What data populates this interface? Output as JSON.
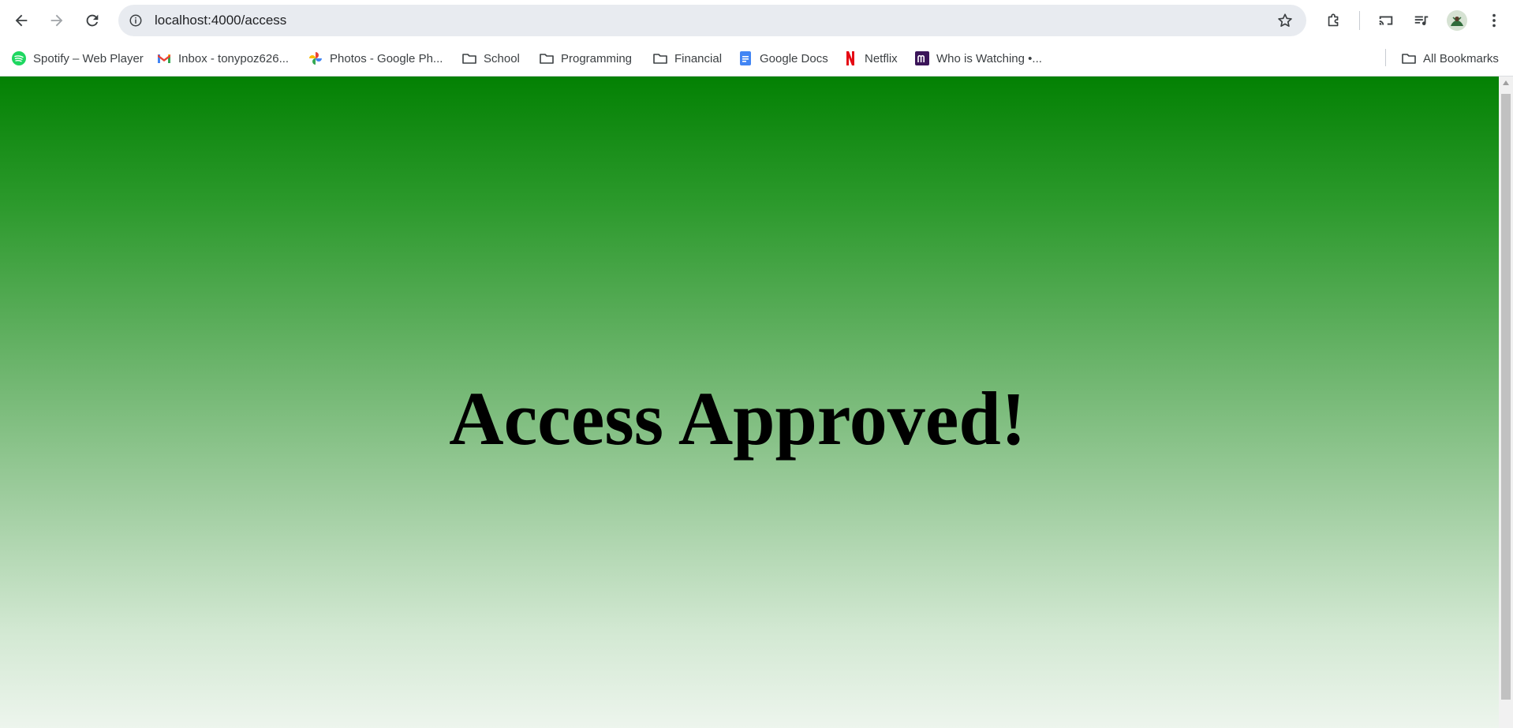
{
  "browser": {
    "url": "localhost:4000/access",
    "avatar_color": "#d6e2d3"
  },
  "bookmarks": [
    {
      "label": "Spotify – Web Player",
      "icon": "spotify-icon"
    },
    {
      "label": "Inbox - tonypoz626...",
      "icon": "gmail-icon"
    },
    {
      "label": "Photos - Google Ph...",
      "icon": "google-photos-icon"
    },
    {
      "label": "School",
      "icon": "folder-icon"
    },
    {
      "label": "Programming",
      "icon": "folder-icon"
    },
    {
      "label": "Financial",
      "icon": "folder-icon"
    },
    {
      "label": "Google Docs",
      "icon": "google-docs-icon"
    },
    {
      "label": "Netflix",
      "icon": "netflix-icon"
    },
    {
      "label": "Who is Watching •...",
      "icon": "m-logo-icon"
    }
  ],
  "all_bookmarks_label": "All Bookmarks",
  "page": {
    "headline": "Access Approved!",
    "gradient_top": "#038103",
    "gradient_bottom": "#edf5ed"
  }
}
